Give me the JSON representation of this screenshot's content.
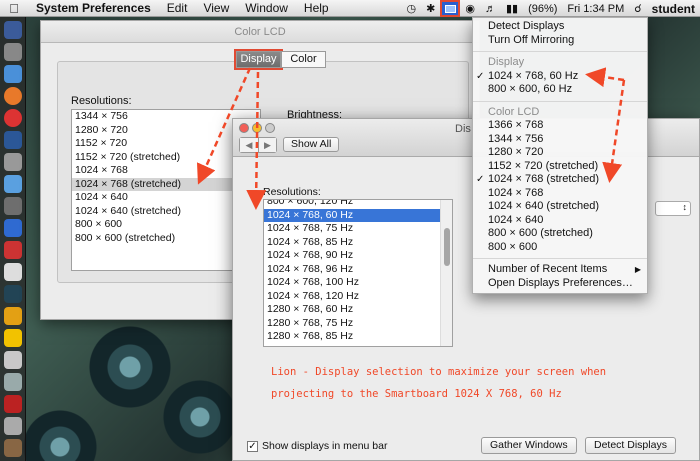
{
  "menubar": {
    "apple": "",
    "app": "System Preferences",
    "items": [
      "Edit",
      "View",
      "Window",
      "Help"
    ],
    "battery": "(96%)",
    "clock": "Fri 1:34 PM",
    "user": "student"
  },
  "back_window": {
    "title": "Color LCD",
    "tabs": [
      "Display",
      "Color"
    ],
    "resolutions_label": "Resolutions:",
    "resolutions": [
      "1344 × 756",
      "1280 × 720",
      "1152 × 720",
      "1152 × 720 (stretched)",
      "1024 × 768",
      "1024 × 768 (stretched)",
      "1024 × 640",
      "1024 × 640 (stretched)",
      "800 × 600",
      "800 × 600 (stretched)"
    ],
    "brightness_label": "Brightness:"
  },
  "front_window": {
    "title": "Dis",
    "show_all": "Show All",
    "resolutions_label": "Resolutions:",
    "resolutions": [
      "800 × 600, 120 Hz",
      "1024 × 768, 60 Hz",
      "1024 × 768, 75 Hz",
      "1024 × 768, 85 Hz",
      "1024 × 768, 90 Hz",
      "1024 × 768, 96 Hz",
      "1024 × 768, 100 Hz",
      "1024 × 768, 120 Hz",
      "1280 × 768, 60 Hz",
      "1280 × 768, 75 Hz",
      "1280 × 768, 85 Hz"
    ],
    "note_line1": "Lion - Display selection to maximize your screen when",
    "note_line2": "projecting to the Smartboard 1024 X 768, 60 Hz",
    "checkbox_label": "Show displays in menu bar",
    "gather_windows": "Gather Windows",
    "detect_displays": "Detect Displays"
  },
  "dropdown": {
    "detect": "Detect Displays",
    "turn_off_mirroring": "Turn Off Mirroring",
    "display_header": "Display",
    "display_items": [
      "1024 × 768, 60 Hz",
      "800 × 600, 60 Hz"
    ],
    "color_lcd_header": "Color LCD",
    "lcd_items": [
      "1366 × 768",
      "1344 × 756",
      "1280 × 720",
      "1152 × 720 (stretched)",
      "1024 × 768 (stretched)",
      "1024 × 768",
      "1024 × 640 (stretched)",
      "1024 × 640",
      "800 × 600 (stretched)",
      "800 × 600"
    ],
    "recent": "Number of Recent Items",
    "open_prefs": "Open Displays Preferences…"
  },
  "colors": {
    "annotation": "#f04828",
    "selection": "#3875d7"
  }
}
